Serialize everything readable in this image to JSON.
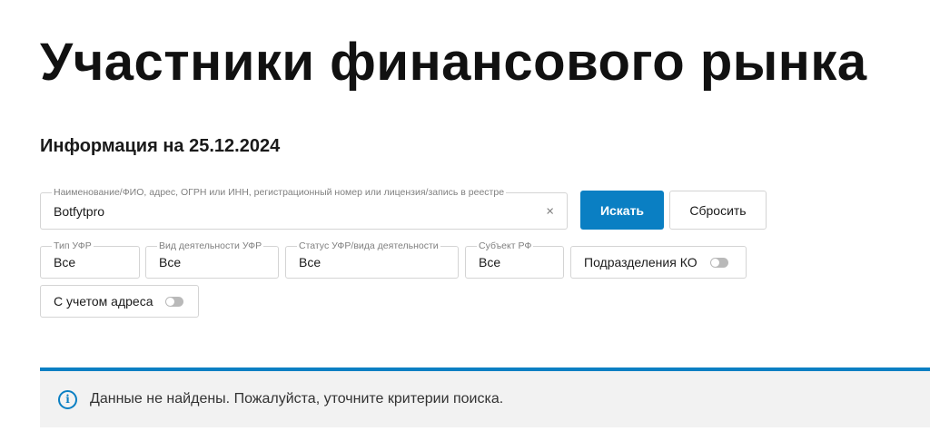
{
  "page": {
    "title": "Участники финансового рынка",
    "info_date": "Информация на 25.12.2024"
  },
  "search": {
    "label": "Наименование/ФИО, адрес, ОГРН или ИНН, регистрационный номер или лицензия/запись в реестре",
    "value": "Botfytpro",
    "clear_icon": "×",
    "search_button": "Искать",
    "reset_button": "Сбросить"
  },
  "filters": {
    "ufr_type": {
      "label": "Тип УФР",
      "value": "Все"
    },
    "activity_type": {
      "label": "Вид деятельности УФР",
      "value": "Все"
    },
    "status": {
      "label": "Статус УФР/вида деятельности",
      "value": "Все"
    },
    "region": {
      "label": "Субъект РФ",
      "value": "Все"
    },
    "ko_divisions": {
      "label": "Подразделения КО",
      "on": false
    },
    "with_address": {
      "label": "С учетом адреса",
      "on": false
    }
  },
  "notice": {
    "icon": "info-icon",
    "icon_glyph": "i",
    "text": "Данные не найдены. Пожалуйста, уточните критерии поиска."
  },
  "colors": {
    "accent": "#0a7fc3",
    "notice_bg": "#f2f2f2"
  }
}
